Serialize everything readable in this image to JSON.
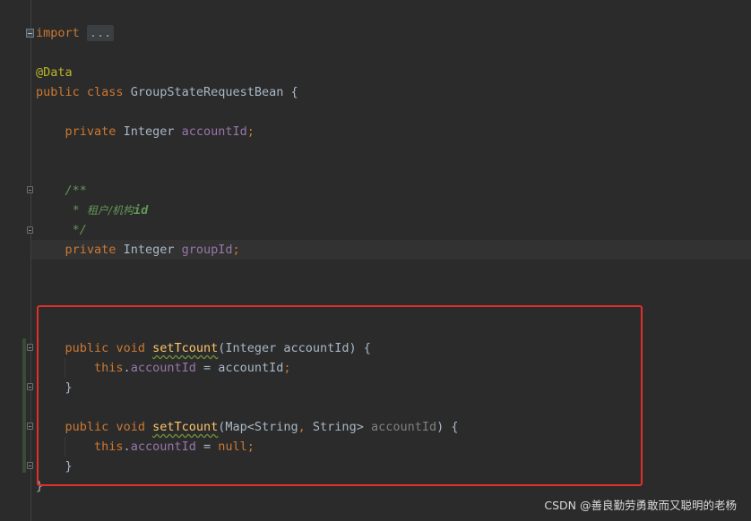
{
  "editor": {
    "top_clip": "",
    "import_keyword": "import",
    "import_fold": "...",
    "annotation": "@Data",
    "class_decl": {
      "kw_public": "public",
      "kw_class": "class",
      "name": "GroupStateRequestBean",
      "brace": " {"
    },
    "field1": {
      "kw_private": "private",
      "type": "Integer",
      "name": "accountId",
      "semi": ";"
    },
    "javadoc": {
      "open": "/**",
      "star": " * ",
      "text": "租户/机构",
      "tag": "id",
      "close": " */"
    },
    "field2": {
      "kw_private": "private",
      "type": "Integer",
      "name": "groupId",
      "semi": ";"
    },
    "method1": {
      "kw_public": "public",
      "kw_void": "void",
      "name": "setTcount",
      "params": "(Integer accountId) {",
      "body_this": "this",
      "body_dot": ".",
      "body_field": "accountId",
      "body_rest": " = accountId",
      "body_semi": ";",
      "close": "}"
    },
    "method2": {
      "kw_public": "public",
      "kw_void": "void",
      "name": "setTcount",
      "params_open": "(Map<String",
      "comma": ",",
      "params_mid": " String> ",
      "param_name": "accountId",
      "params_close": ") {",
      "body_this": "this",
      "body_dot": ".",
      "body_field": "accountId",
      "body_eq": " = ",
      "body_null": "null",
      "body_semi": ";",
      "close": "}"
    },
    "class_close": "}"
  },
  "watermark": "CSDN @善良勤劳勇敢而又聪明的老杨",
  "colors": {
    "background": "#2b2b2b",
    "keyword": "#cc7832",
    "annotation": "#bbb529",
    "field": "#9876aa",
    "comment": "#629755",
    "method": "#ffc66d",
    "highlight_box": "#e1302a"
  }
}
